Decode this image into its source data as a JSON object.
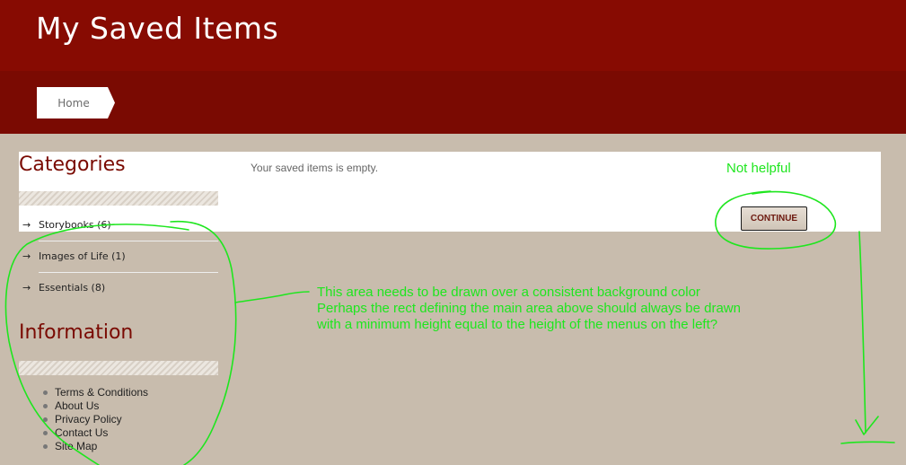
{
  "header": {
    "title": "My Saved Items"
  },
  "nav": {
    "home_label": "Home"
  },
  "main": {
    "empty_message": "Your saved items is empty.",
    "continue_label": "CONTINUE"
  },
  "sidebar": {
    "categories_heading": "Categories",
    "categories": [
      {
        "arrow": "→",
        "label": "Storybooks (6)"
      },
      {
        "arrow": "→",
        "label": "Images of Life (1)"
      },
      {
        "arrow": "→",
        "label": "Essentials (8)"
      }
    ],
    "information_heading": "Information",
    "information_links": [
      "Terms & Conditions",
      "About Us",
      "Privacy Policy",
      "Contact Us",
      "Site Map"
    ]
  },
  "annotations": {
    "continue_note": "Not helpful",
    "layout_note": [
      "This area needs to be drawn over a consistent background color",
      "Perhaps the rect defining the main area above should always be drawn",
      "with a minimum height equal to the height of the menus on the left?"
    ],
    "color": "#1ee61e"
  },
  "colors": {
    "header_bg": "#870b02",
    "nav_bg": "#7a0a02",
    "page_bg": "#c8bcad",
    "heading_text": "#7a0a02"
  }
}
